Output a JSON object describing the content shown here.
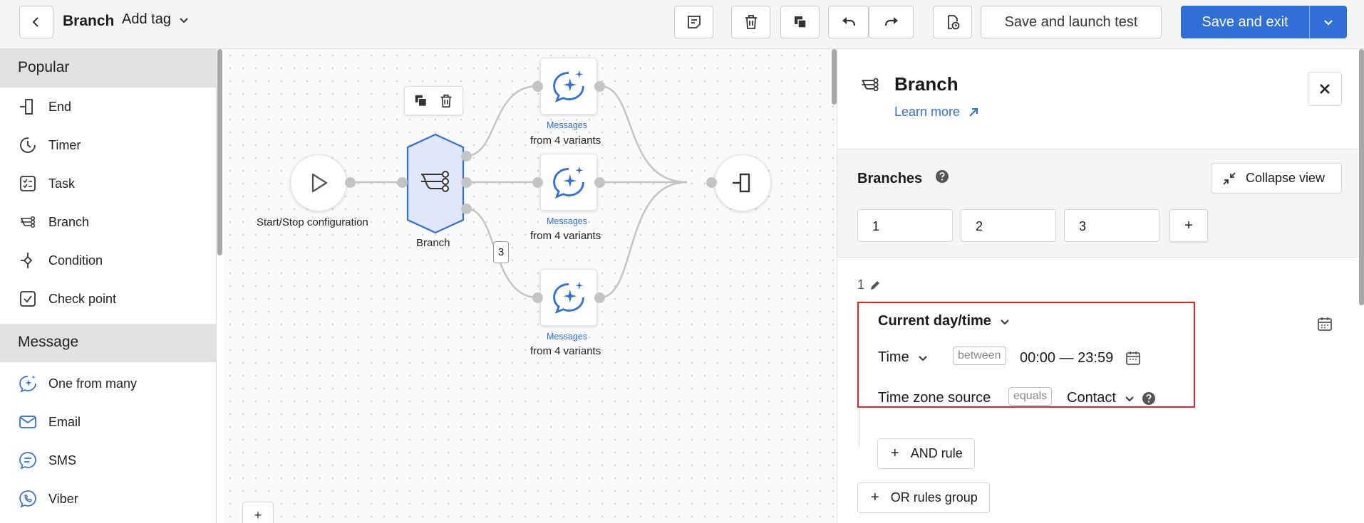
{
  "header": {
    "title": "Branch",
    "add_tag": "Add tag",
    "save_launch": "Save and launch test",
    "save_exit": "Save and exit"
  },
  "sidebar": {
    "popular_title": "Popular",
    "popular": [
      {
        "label": "End",
        "icon": "end-icon"
      },
      {
        "label": "Timer",
        "icon": "timer-icon"
      },
      {
        "label": "Task",
        "icon": "task-icon"
      },
      {
        "label": "Branch",
        "icon": "branch-icon"
      },
      {
        "label": "Condition",
        "icon": "condition-icon"
      },
      {
        "label": "Check point",
        "icon": "check-point-icon"
      }
    ],
    "message_title": "Message",
    "message": [
      {
        "label": "One from many",
        "icon": "sparkle-chat-icon"
      },
      {
        "label": "Email",
        "icon": "email-icon"
      },
      {
        "label": "SMS",
        "icon": "sms-icon"
      },
      {
        "label": "Viber",
        "icon": "viber-icon"
      }
    ]
  },
  "canvas": {
    "start_label": "Start/Stop configuration",
    "branch_label": "Branch",
    "message_title": "Messages",
    "message_sub": "from 4 variants",
    "badge": "3",
    "add_button": "+"
  },
  "panel": {
    "title": "Branch",
    "learn_more": "Learn more",
    "branches_label": "Branches",
    "collapse": "Collapse view",
    "tabs": [
      "1",
      "2",
      "3"
    ],
    "add_tab": "+",
    "group_index": "1",
    "rule_title": "Current day/time",
    "time_label": "Time",
    "between": "between",
    "time_range": "00:00 — 23:59",
    "tz_label": "Time zone source",
    "equals": "equals",
    "contact": "Contact",
    "and_rule": "AND rule",
    "or_group": "OR rules group"
  },
  "colors": {
    "accent": "#2f6fd6",
    "highlight": "#e8202a",
    "branch_fill": "#dfe7f8"
  }
}
